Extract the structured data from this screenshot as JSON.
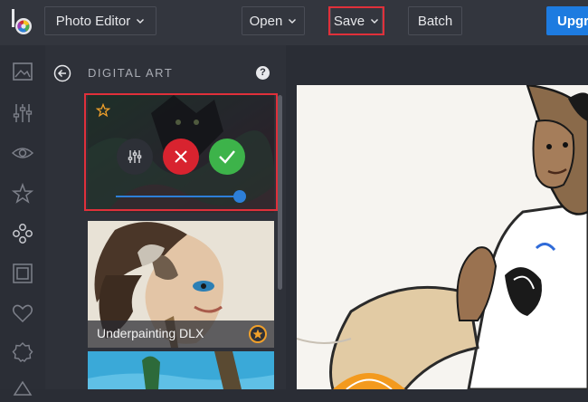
{
  "topbar": {
    "app_menu_label": "Photo Editor",
    "open_label": "Open",
    "save_label": "Save",
    "batch_label": "Batch",
    "upgrade_label": "Upgr"
  },
  "iconbar": {
    "items": [
      "image-icon",
      "sliders-icon",
      "eye-icon",
      "star-icon",
      "effects-icon",
      "frame-icon",
      "heart-icon",
      "badge-icon",
      "shapes-icon"
    ]
  },
  "panel": {
    "title": "DIGITAL ART",
    "help_symbol": "?",
    "active_effect": {
      "intensity": 1.0
    },
    "effects": [
      {
        "label": "Underpainting DLX",
        "premium": true
      }
    ]
  },
  "colors": {
    "accent": "#1d7be0",
    "highlight": "#e0303a",
    "cancel": "#d8232f",
    "confirm": "#3db34a",
    "premium": "#f0a02a"
  }
}
